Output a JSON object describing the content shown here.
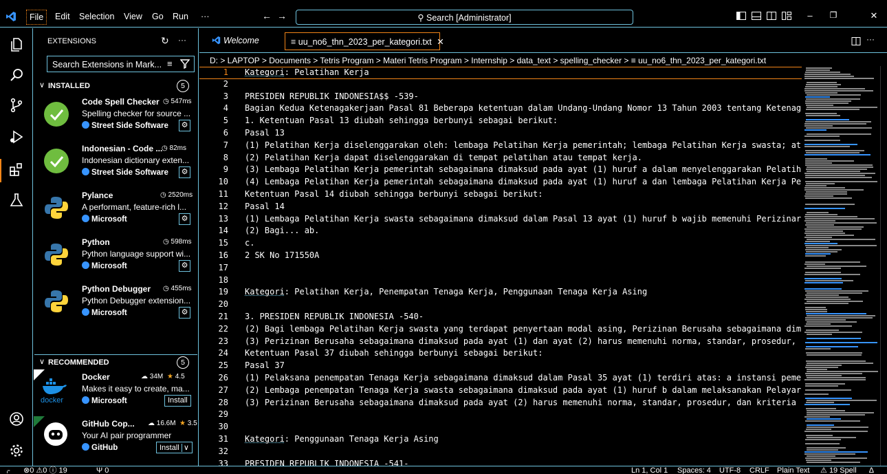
{
  "titlebar": {
    "menus": [
      "File",
      "Edit",
      "Selection",
      "View",
      "Go",
      "Run",
      "···"
    ],
    "search": "Search [Administrator]"
  },
  "sidebar": {
    "title": "EXTENSIONS",
    "search_placeholder": "Search Extensions in Mark...",
    "installed": {
      "label": "INSTALLED",
      "count": "5"
    },
    "installed_items": [
      {
        "name": "Code Spell Checker",
        "meta": "547ms",
        "desc": "Spelling checker for source ...",
        "publisher": "Street Side Software"
      },
      {
        "name": "Indonesian - Code ...",
        "meta": "82ms",
        "desc": "Indonesian dictionary exten...",
        "publisher": "Street Side Software"
      },
      {
        "name": "Pylance",
        "meta": "2520ms",
        "desc": "A performant, feature-rich l...",
        "publisher": "Microsoft"
      },
      {
        "name": "Python",
        "meta": "598ms",
        "desc": "Python language support wi...",
        "publisher": "Microsoft"
      },
      {
        "name": "Python Debugger",
        "meta": "455ms",
        "desc": "Python Debugger extension...",
        "publisher": "Microsoft"
      }
    ],
    "recommended": {
      "label": "RECOMMENDED",
      "count": "5"
    },
    "recommended_items": [
      {
        "name": "Docker",
        "downloads": "34M",
        "rating": "4.5",
        "desc": "Makes it easy to create, ma...",
        "publisher": "Microsoft",
        "button": "Install",
        "logo_text": "docker"
      },
      {
        "name": "GitHub Cop...",
        "downloads": "16.6M",
        "rating": "3.5",
        "desc": "Your AI pair programmer",
        "publisher": "GitHub",
        "button": "Install"
      }
    ]
  },
  "tabs": [
    {
      "label": "Welcome"
    },
    {
      "label": "uu_no6_thn_2023_per_kategori.txt"
    }
  ],
  "breadcrumb": "D: > LAPTOP > Documents > Tetris Program > Materi Tetris Program > Internship > data_text > spelling_checker > ≡ uu_no6_thn_2023_per_kategori.txt",
  "editor": {
    "lines": [
      {
        "n": "1",
        "t": "Kategori: Pelatihan Kerja"
      },
      {
        "n": "2",
        "t": ""
      },
      {
        "n": "3",
        "t": "PRESIDEN REPUBLIK INDONESIA$$ -539-"
      },
      {
        "n": "4",
        "t": "Bagian Kedua Ketenagakerjaan Pasal 81 Beberapa ketentuan dalam Undang-Undang Nomor 13 Tahun 2003 tentang Ketenag"
      },
      {
        "n": "5",
        "t": "1. Ketentuan Pasal 13 diubah sehingga berbunyi sebagai berikut:"
      },
      {
        "n": "6",
        "t": "Pasal 13"
      },
      {
        "n": "7",
        "t": "(1) Pelatihan Kerja diselenggarakan oleh: lembaga Pelatihan Kerja pemerintah; lembaga Pelatihan Kerja swasta; at"
      },
      {
        "n": "8",
        "t": "(2) Pelatihan Kerja dapat diselenggarakan di tempat pelatihan atau tempat kerja."
      },
      {
        "n": "9",
        "t": "(3) Lembaga Pelatihan Kerja pemerintah sebagaimana dimaksud pada ayat (1) huruf a dalam menyelenggarakan Pelatih"
      },
      {
        "n": "10",
        "t": "(4) Lembaga Pelatihan Kerja pemerintah sebagaimana dimaksud pada ayat (1) huruf a dan lembaga Pelatihan Kerja Pe"
      },
      {
        "n": "11",
        "t": "Ketentuan Pasal 14 diubah sehingga berbunyi sebagai berikut:"
      },
      {
        "n": "12",
        "t": "Pasal 14"
      },
      {
        "n": "13",
        "t": "(1) Lembaga Pelatihan Kerja swasta sebagaimana dimaksud dalam Pasal 13 ayat (1) huruf b wajib memenuhi Perizinar"
      },
      {
        "n": "14",
        "t": "(2) Bagi... ab."
      },
      {
        "n": "15",
        "t": "c."
      },
      {
        "n": "16",
        "t": "2 SK No 171550A"
      },
      {
        "n": "17",
        "t": ""
      },
      {
        "n": "18",
        "t": ""
      },
      {
        "n": "19",
        "t": "Kategori: Pelatihan Kerja, Penempatan Tenaga Kerja, Penggunaan Tenaga Kerja Asing"
      },
      {
        "n": "20",
        "t": ""
      },
      {
        "n": "21",
        "t": "3. PRESIDEN REPUBLIK INDONESIA -540-"
      },
      {
        "n": "22",
        "t": "(2) Bagi lembaga Pelatihan Kerja swasta yang terdapat penyertaan modal asing, Perizinan Berusaha sebagaimana dim"
      },
      {
        "n": "23",
        "t": "(3) Perizinan Berusaha sebagaimana dimaksud pada ayat (1) dan ayat (2) harus memenuhi norma, standar, prosedur,"
      },
      {
        "n": "24",
        "t": "Ketentuan Pasal 37 diubah sehingga berbunyi sebagai berikut:"
      },
      {
        "n": "25",
        "t": "Pasal 37"
      },
      {
        "n": "26",
        "t": "(1) Pelaksana penempatan Tenaga Kerja sebagaimana dimaksud dalam Pasal 35 ayat (1) terdiri atas: a instansi peme"
      },
      {
        "n": "27",
        "t": "(2) Lembaga penempatan Tenaga Kerja swasta sebagaimana dimaksud pada ayat (1) huruf b dalam melaksanakan Pelayar"
      },
      {
        "n": "28",
        "t": "(3) Perizinan Berusaha sebagaimana dimaksud pada ayat (2) harus memenuhi norma, standar, prosedur, dan kriteria"
      },
      {
        "n": "29",
        "t": ""
      },
      {
        "n": "30",
        "t": ""
      },
      {
        "n": "31",
        "t": "Kategori: Penggunaan Tenaga Kerja Asing"
      },
      {
        "n": "32",
        "t": ""
      },
      {
        "n": "33",
        "t": "PRESIDEN REPUBLIK INDONESIA -541-"
      }
    ]
  },
  "statusbar": {
    "errors": "0",
    "warnings": "0",
    "info": "19",
    "ports": "0",
    "position": "Ln 1, Col 1",
    "spaces": "Spaces: 4",
    "encoding": "UTF-8",
    "eol": "CRLF",
    "language": "Plain Text",
    "spell": "19 Spell"
  }
}
